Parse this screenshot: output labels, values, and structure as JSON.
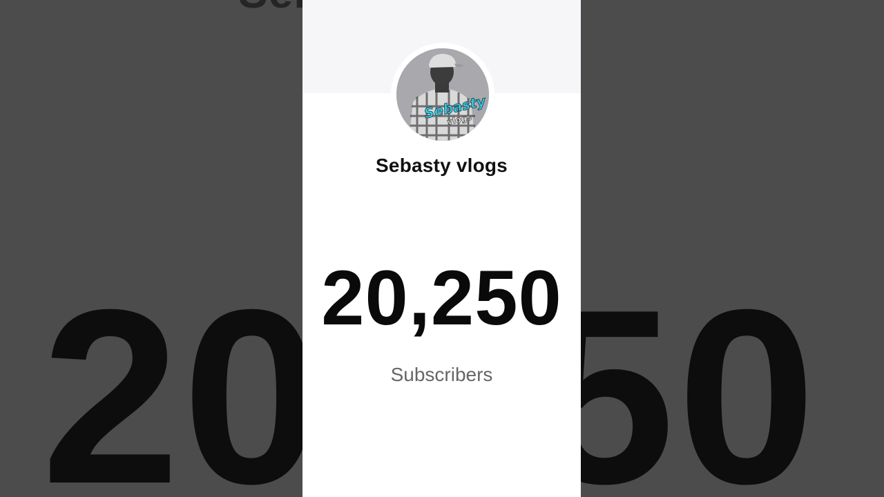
{
  "background": {
    "channel_echo": "Sebasty vlogs",
    "count_echo": "20,250"
  },
  "channel": {
    "name": "Sebasty vlogs",
    "avatar_overlay_text": "Sebasty",
    "avatar_overlay_subtext": "vlogs"
  },
  "stats": {
    "subscriber_count": "20,250",
    "subscriber_label": "Subscribers"
  },
  "colors": {
    "backdrop": "#4c4c4c",
    "card": "#ffffff",
    "avatar_text_accent": "#3fc7e0"
  }
}
